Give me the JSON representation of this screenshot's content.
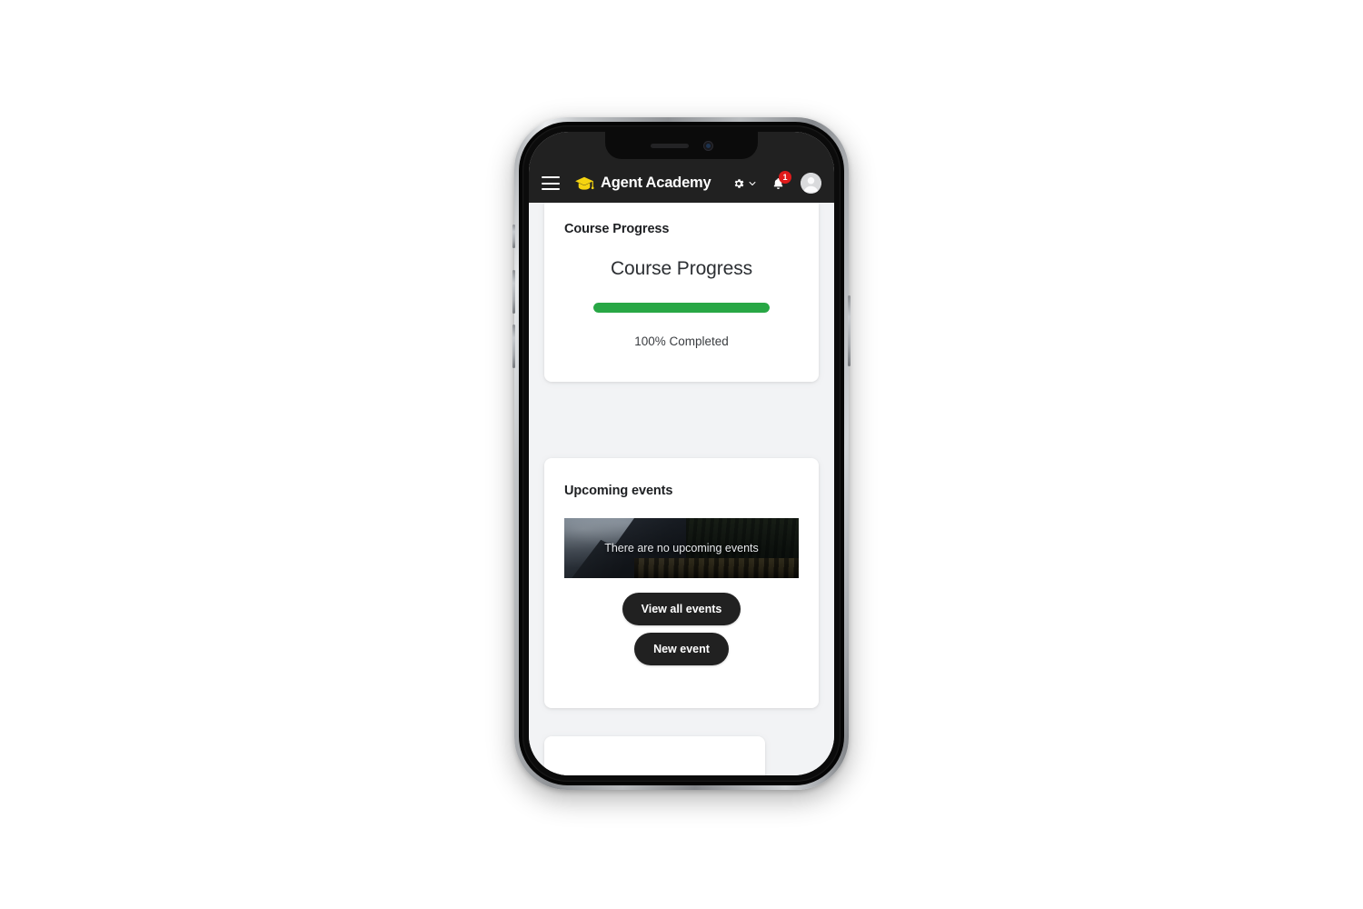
{
  "app": {
    "header": {
      "menu_icon": "hamburger-menu-icon",
      "brand_icon": "graduation-cap-icon",
      "brand_name": "Agent Academy",
      "settings_icon": "gear-icon",
      "settings_chevron_icon": "chevron-down-icon",
      "notifications_icon": "bell-icon",
      "notifications_count": "1",
      "avatar_icon": "user-avatar-icon",
      "background_color": "#212121",
      "badge_color": "#e01b1b",
      "brand_icon_color": "#f5d410"
    },
    "cards": {
      "course_progress": {
        "heading": "Course Progress",
        "title": "Course Progress",
        "progress_percent": 100,
        "progress_label": "100% Completed",
        "bar_color": "#28a745"
      },
      "upcoming_events": {
        "heading": "Upcoming events",
        "banner_text": "There are no upcoming events",
        "buttons": [
          {
            "label": "View all events",
            "name": "view-all-events-button"
          },
          {
            "label": "New event",
            "name": "new-event-button"
          }
        ]
      }
    },
    "page_background": "#f2f3f5"
  },
  "device": {
    "type": "smartphone-mockup",
    "notch_speaker": "speaker-grille",
    "notch_camera": "front-camera"
  }
}
